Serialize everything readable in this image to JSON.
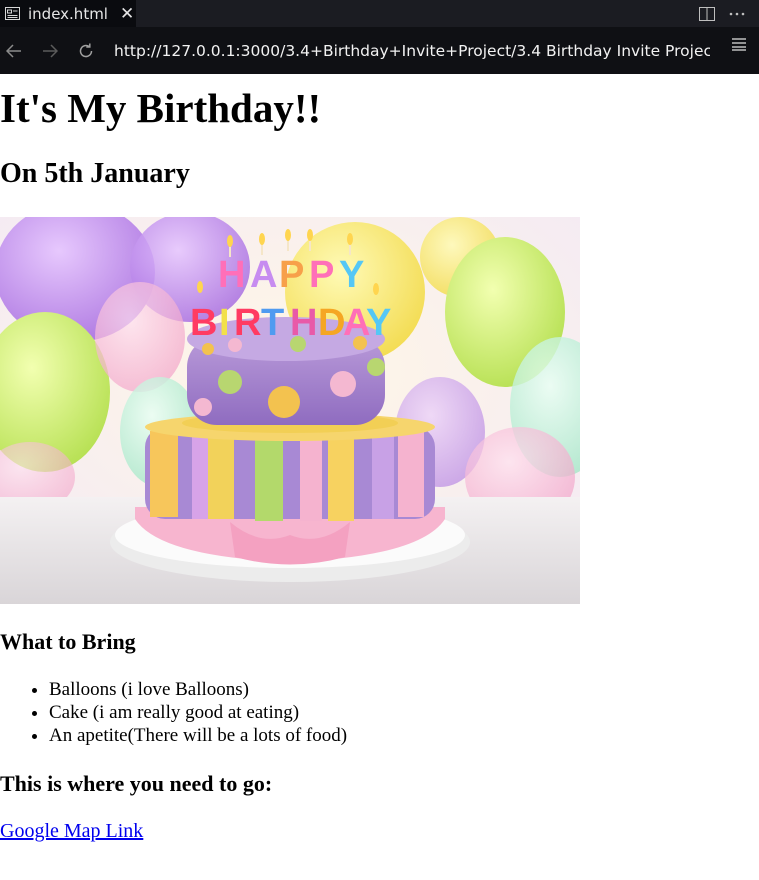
{
  "browser": {
    "tab_title": "index.html",
    "tab_close": "✕",
    "url": "http://127.0.0.1:3000/3.4+Birthday+Invite+Project/3.4 Birthday Invite Project/inde"
  },
  "page": {
    "title": "It's My Birthday!!",
    "date": "On 5th January",
    "bring_heading": "What to Bring",
    "bring_items": [
      "Balloons (i love Balloons)",
      "Cake (i am really good at eating)",
      "An apetite(There will be a lots of food)"
    ],
    "where_heading": "This is where you need to go:",
    "map_link": "Google Map Link"
  },
  "cake_image": {
    "letters_top": [
      "H",
      "A",
      "P",
      "P",
      "Y"
    ],
    "letters_bottom": [
      "B",
      "I",
      "R",
      "T",
      "H",
      "D",
      "A",
      "Y"
    ]
  },
  "colors": {
    "link": "#0000ee",
    "tab_bar": "#1b1c22",
    "nav_bar": "#0f1014"
  }
}
